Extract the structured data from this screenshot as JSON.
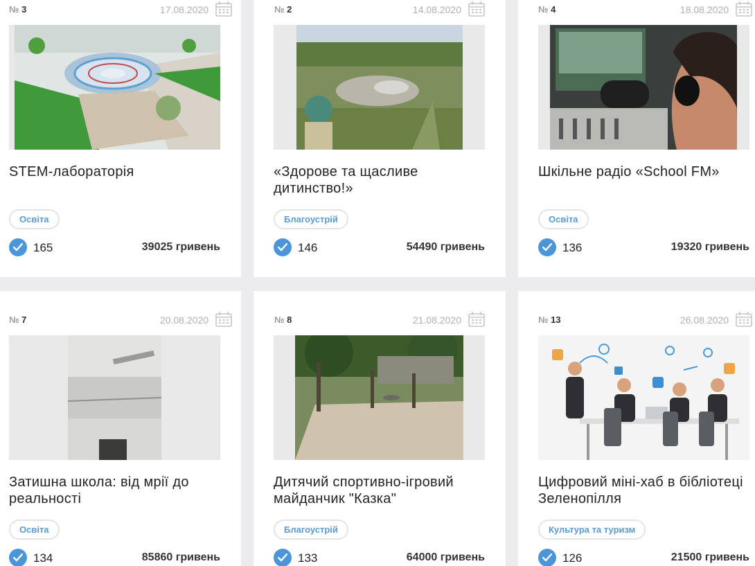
{
  "cards": [
    {
      "num_prefix": "№",
      "number": "3",
      "date": "17.08.2020",
      "title": "STEM-лабораторія",
      "tag": "Освіта",
      "votes": "165",
      "amount": "39025 гривень"
    },
    {
      "num_prefix": "№",
      "number": "2",
      "date": "14.08.2020",
      "title": "«Здорове та щасливе дитинство!»",
      "tag": "Благоустрій",
      "votes": "146",
      "amount": "54490 гривень"
    },
    {
      "num_prefix": "№",
      "number": "4",
      "date": "18.08.2020",
      "title": "Шкільне радіо «School FM»",
      "tag": "Освіта",
      "votes": "136",
      "amount": "19320 гривень"
    },
    {
      "num_prefix": "№",
      "number": "7",
      "date": "20.08.2020",
      "title": "Затишна школа: від мрії до реальності",
      "tag": "Освіта",
      "votes": "134",
      "amount": "85860 гривень"
    },
    {
      "num_prefix": "№",
      "number": "8",
      "date": "21.08.2020",
      "title": "Дитячий спортивно-ігровий майданчик \"Казка\"",
      "tag": "Благоустрій",
      "votes": "133",
      "amount": "64000 гривень"
    },
    {
      "num_prefix": "№",
      "number": "13",
      "date": "26.08.2020",
      "title": "Цифровий міні-хаб в бібліотеці Зеленопілля",
      "tag": "Культура та туризм",
      "votes": "126",
      "amount": "21500 гривень"
    }
  ],
  "icons": {
    "date": "calendar-icon",
    "vote": "checkmark-icon"
  },
  "colors": {
    "accent": "#4a96d8",
    "tag_text": "#5a9bd5",
    "background": "#ececee"
  }
}
